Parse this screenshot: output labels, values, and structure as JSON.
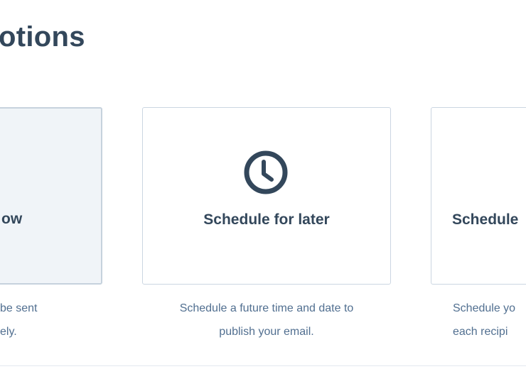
{
  "section": {
    "title": "Scheduling options",
    "visible_title": "otions"
  },
  "options": [
    {
      "title": "Send now",
      "visible_title": "ow",
      "desc_line1": "be sent",
      "desc_line2": "ely.",
      "selected": true
    },
    {
      "title": "Schedule for later",
      "icon": "clock-icon",
      "desc_line1": "Schedule a future time and date to",
      "desc_line2": "publish your email.",
      "selected": false
    },
    {
      "title": "Schedule",
      "desc_line1": "Schedule yo",
      "desc_line2": "each recipi",
      "selected": false
    }
  ],
  "colors": {
    "heading": "#33475b",
    "body_text": "#516f90",
    "card_border": "#cbd6e2",
    "selected_bg": "#f0f4f8"
  }
}
